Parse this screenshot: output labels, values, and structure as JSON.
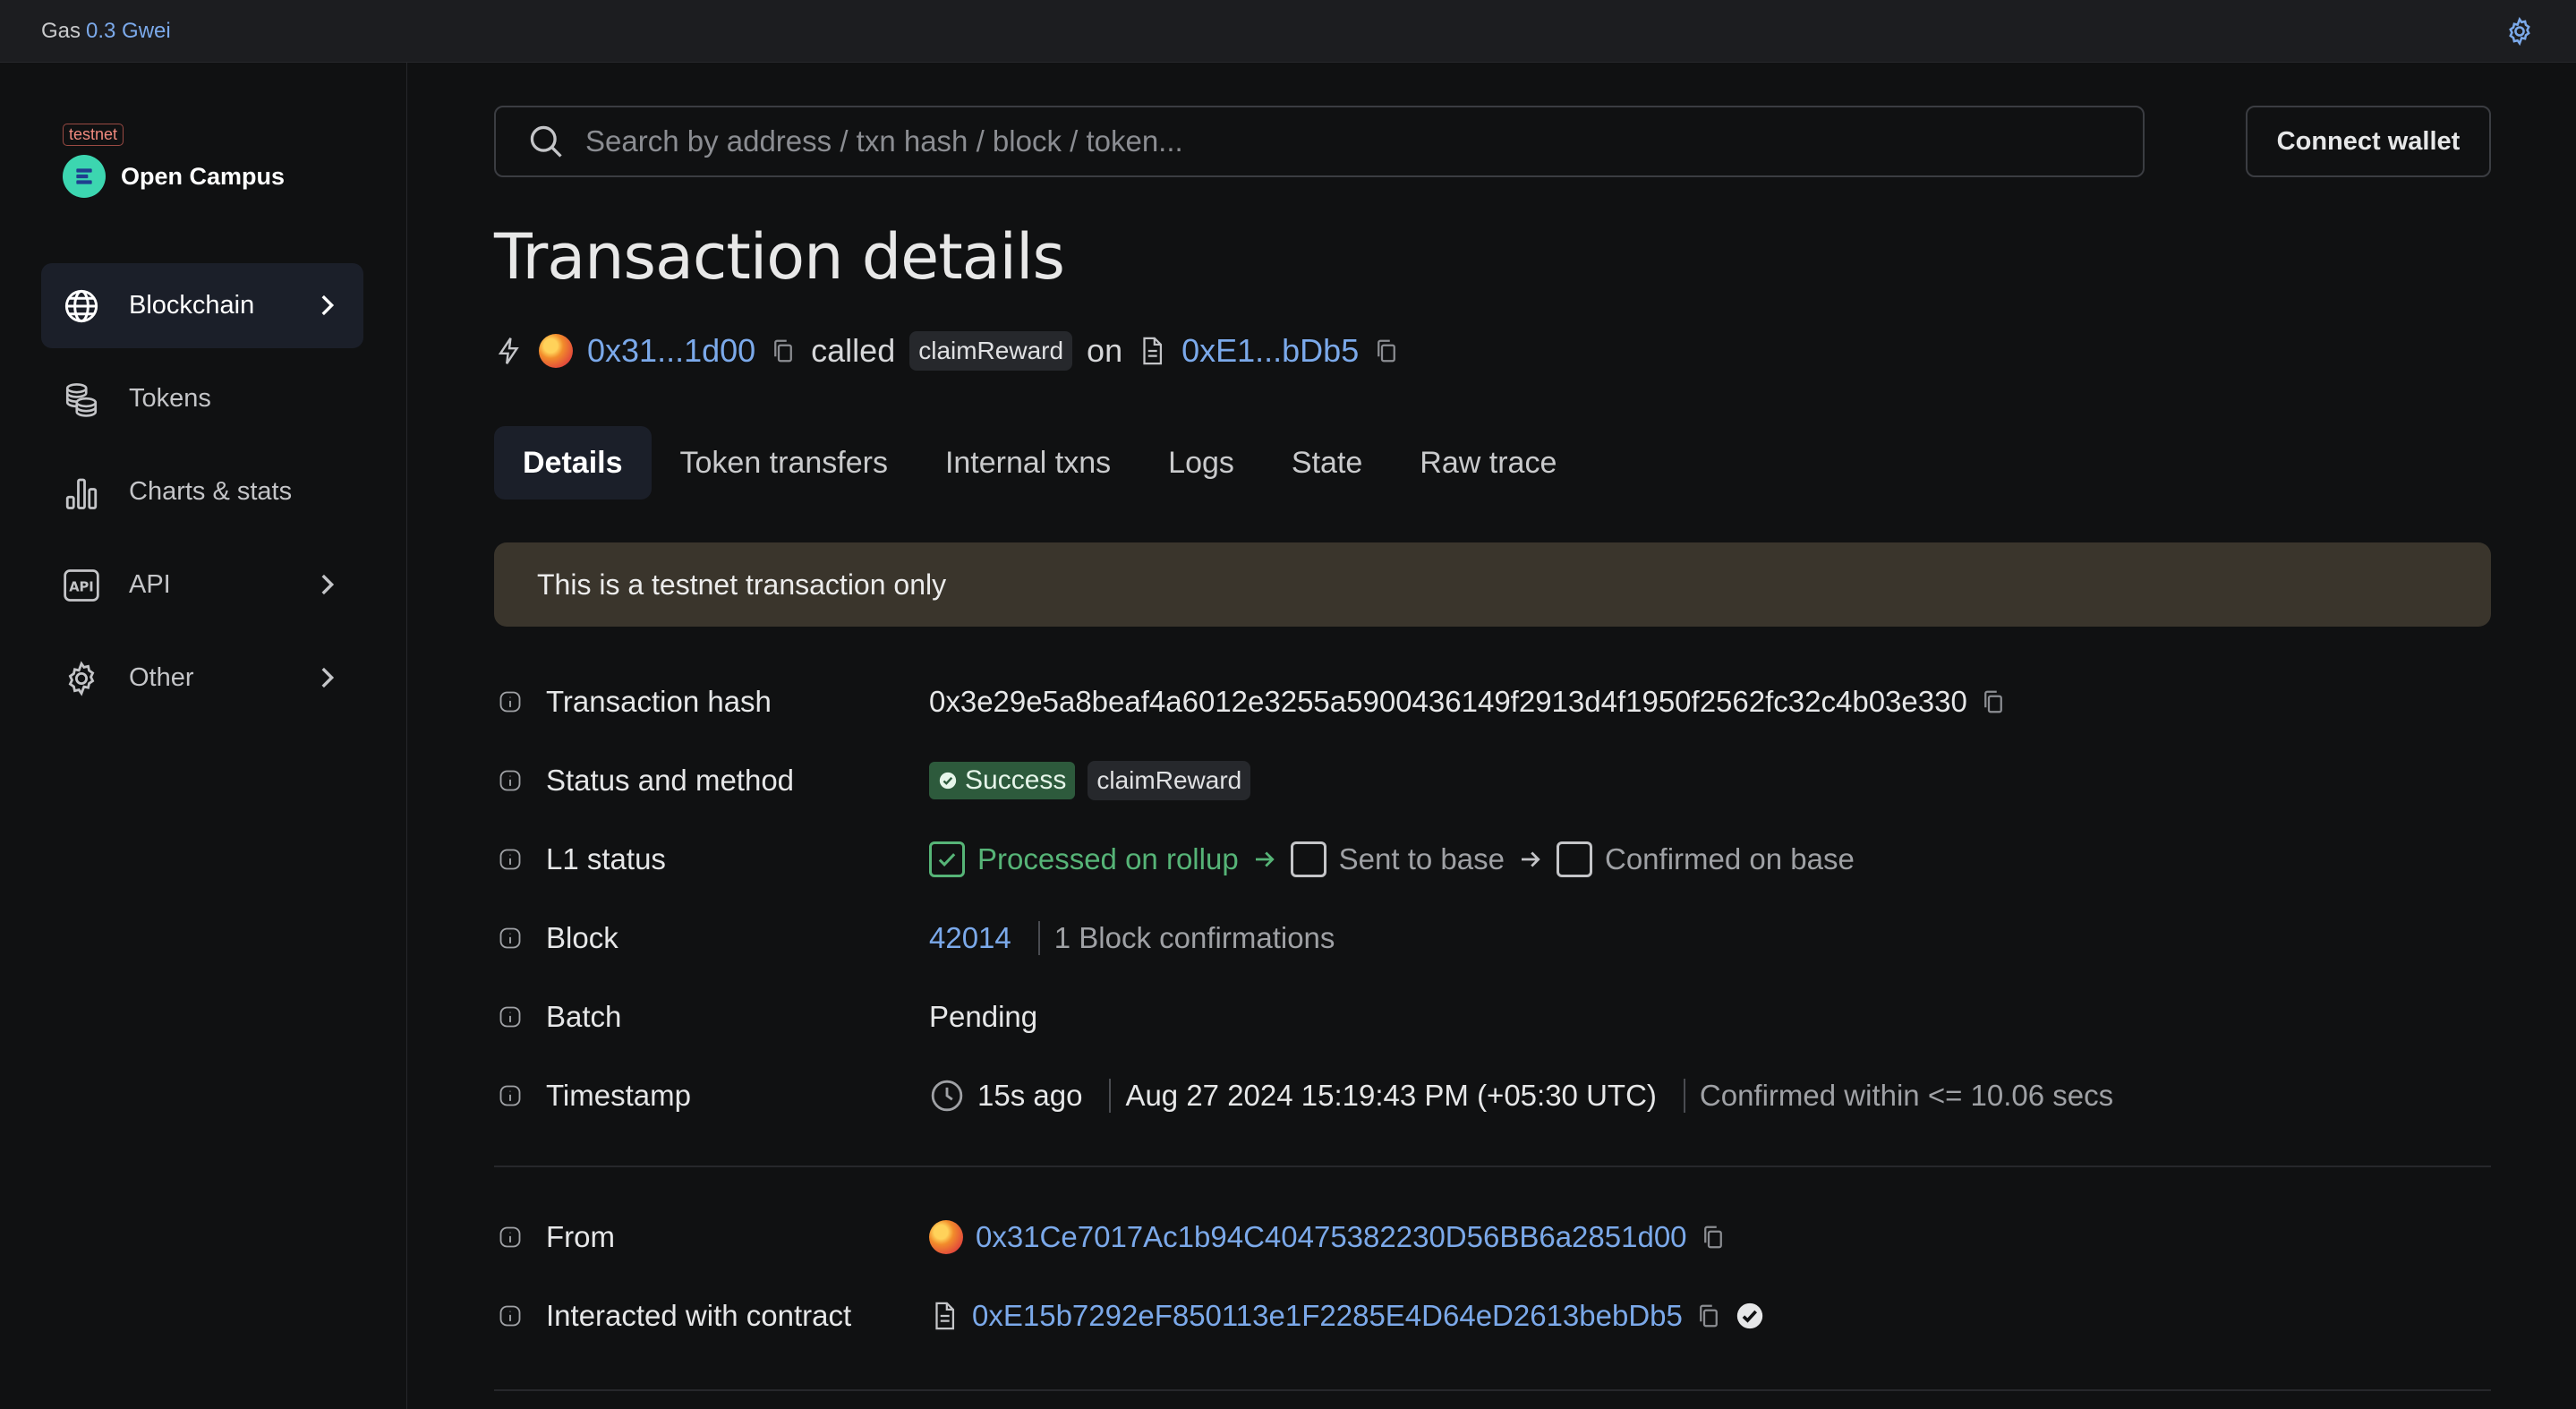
{
  "topbar": {
    "gas_label": "Gas",
    "gas_value": "0.3 Gwei"
  },
  "brand": {
    "badge": "testnet",
    "name": "Open Campus"
  },
  "sidebar": {
    "items": [
      {
        "label": "Blockchain",
        "icon": "globe-icon",
        "active": true,
        "chevron": true
      },
      {
        "label": "Tokens",
        "icon": "coins-icon",
        "active": false,
        "chevron": false
      },
      {
        "label": "Charts & stats",
        "icon": "bar-chart-icon",
        "active": false,
        "chevron": false
      },
      {
        "label": "API",
        "icon": "api-icon",
        "active": false,
        "chevron": true
      },
      {
        "label": "Other",
        "icon": "gear-icon",
        "active": false,
        "chevron": true
      }
    ]
  },
  "search": {
    "placeholder": "Search by address / txn hash / block / token..."
  },
  "connect_wallet": "Connect wallet",
  "page_title": "Transaction details",
  "summary": {
    "from_short": "0x31...1d00",
    "called": "called",
    "method": "claimReward",
    "on": "on",
    "to_short": "0xE1...bDb5"
  },
  "tabs": [
    "Details",
    "Token transfers",
    "Internal txns",
    "Logs",
    "State",
    "Raw trace"
  ],
  "alert": "This is a testnet transaction only",
  "details": {
    "tx_hash_label": "Transaction hash",
    "tx_hash": "0x3e29e5a8beaf4a6012e3255a5900436149f2913d4f1950f2562fc32c4b03e330",
    "status_label": "Status and method",
    "status": "Success",
    "method": "claimReward",
    "l1_label": "L1 status",
    "l1_steps": [
      "Processed on rollup",
      "Sent to base",
      "Confirmed on base"
    ],
    "block_label": "Block",
    "block": "42014",
    "confirmations": "1 Block confirmations",
    "batch_label": "Batch",
    "batch": "Pending",
    "timestamp_label": "Timestamp",
    "ago": "15s ago",
    "datetime": "Aug 27 2024 15:19:43 PM (+05:30 UTC)",
    "confirmed_within": "Confirmed within <= 10.06 secs",
    "from_label": "From",
    "from": "0x31Ce7017Ac1b94C40475382230D56BB6a2851d00",
    "contract_label": "Interacted with contract",
    "contract": "0xE15b7292eF850113e1F2285E4D64eD2613bebDb5"
  },
  "colors": {
    "accent": "#7ba9ea",
    "success": "#56b477",
    "alert_bg": "#3a352c"
  }
}
